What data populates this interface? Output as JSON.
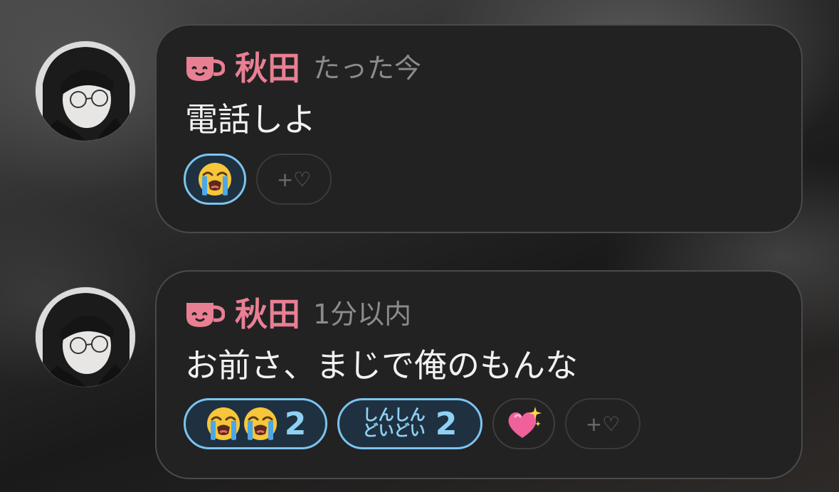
{
  "messages": [
    {
      "author": "秋田",
      "time": "たった今",
      "text": "電話しよ",
      "reactions": [
        {
          "emoji": "loudly-crying-face-icon",
          "active": true
        }
      ],
      "add_reaction_label": "+♡"
    },
    {
      "author": "秋田",
      "time": "1分以内",
      "text": "お前さ、まじで俺のもんな",
      "reactions": [
        {
          "emoji": "loudly-crying-face-icon",
          "emoji_repeat": 2,
          "count": "2",
          "active": true
        },
        {
          "custom_text_line1": "しんしん",
          "custom_text_line2": "どいどい",
          "count": "2",
          "active": true
        },
        {
          "emoji": "sparkling-heart-icon",
          "active": false
        }
      ],
      "add_reaction_label": "+♡"
    }
  ],
  "colors": {
    "author_name": "#e97f93",
    "bubble_bg": "#222223",
    "active_reaction_border": "#7cc4ef",
    "active_reaction_text": "#8fd0f5"
  }
}
